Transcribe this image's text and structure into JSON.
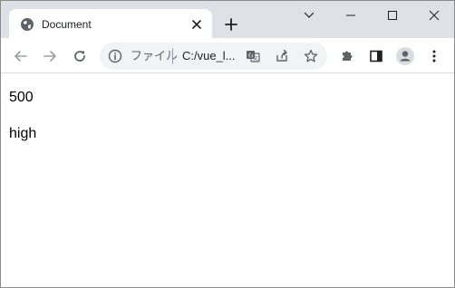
{
  "tab": {
    "title": "Document"
  },
  "address_bar": {
    "scheme_label": "ファイル",
    "url_text": "C:/vue_l..."
  },
  "page": {
    "line1": "500",
    "line2": "high"
  },
  "icons": {
    "favicon": "globe-icon",
    "tab_close": "close-icon",
    "new_tab": "plus-icon",
    "tab_search": "chevron-down-icon",
    "minimize": "minimize-icon",
    "maximize": "maximize-icon",
    "window_close": "close-icon",
    "back": "arrow-left-icon",
    "forward": "arrow-right-icon",
    "reload": "reload-icon",
    "site_info": "info-icon",
    "translate": "translate-icon",
    "share": "share-icon",
    "bookmark": "star-icon",
    "extensions": "puzzle-icon",
    "side_panel": "side-panel-icon",
    "profile": "avatar-icon",
    "menu": "kebab-menu-icon"
  },
  "colors": {
    "titlebar": "#dee1e6",
    "omnibox": "#f1f3f4",
    "icon": "#5f6368",
    "disabled_icon": "#9aa0a6",
    "avatar_bg": "#dadce0"
  }
}
